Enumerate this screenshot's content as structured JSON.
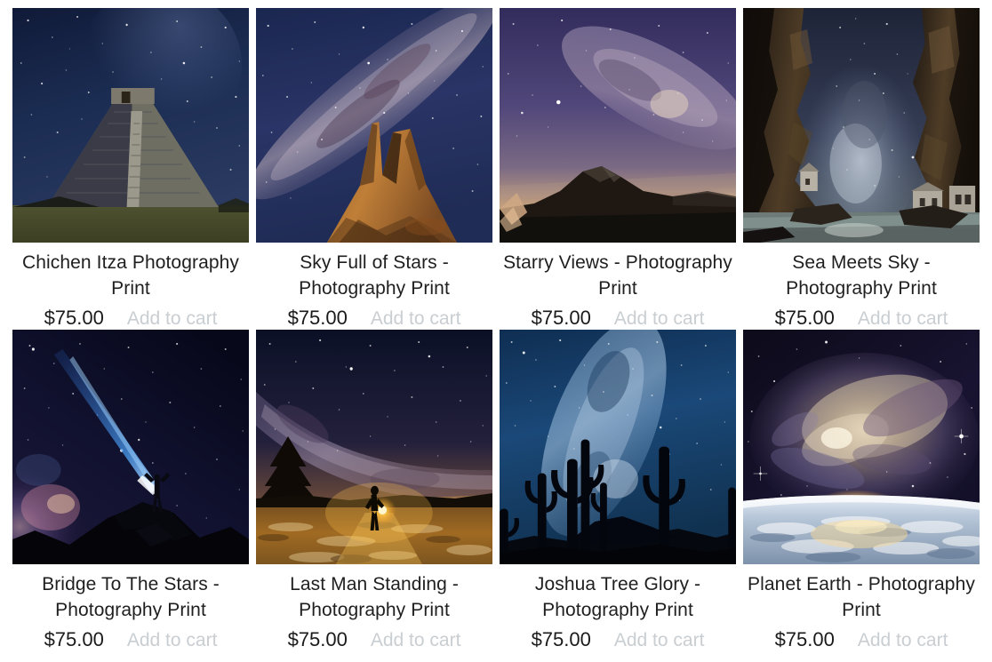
{
  "shop": {
    "grid_columns": 4,
    "currency_symbol": "$",
    "accent_price_color": "#1a1a1a",
    "add_to_cart_color": "#c9ced2",
    "title_color": "#1f1f1f",
    "page_background": "#ffffff"
  },
  "products": [
    {
      "title": "Chichen Itza Photography Print",
      "price": "$75.00",
      "add_to_cart_label": "Add to cart",
      "image_name": "chichen-itza-pyramid-starry-night-photo",
      "image_alt": "Chichen Itza pyramid under a deep blue starry night sky with green grass foreground",
      "palette": {
        "sky_top": "#141e3c",
        "sky_mid": "#1b2c52",
        "sky_low": "#26375e",
        "ground": "#4a4d28",
        "structure": "#8d8b80",
        "structure_shadow": "#2e3040"
      }
    },
    {
      "title": "Sky Full of Stars - Photography Print",
      "price": "$75.00",
      "add_to_cart_label": "Add to cart",
      "image_name": "rock-spires-milky-way-photo",
      "image_alt": "Orange lit rock spires rising toward the Milky Way galactic core",
      "palette": {
        "sky_top": "#1c2a52",
        "sky_mid": "#2c3566",
        "sky_low": "#24335c",
        "galaxy": "#9a8fa8",
        "rock_lit": "#b0702f",
        "rock_dark": "#4a2c16"
      }
    },
    {
      "title": "Starry Views - Photography Print",
      "price": "$75.00",
      "add_to_cart_label": "Add to cart",
      "image_name": "mountain-silhouette-purple-starry-sky-photo",
      "image_alt": "Purple starry sky with the Milky Way above a dark mountain ridge and warm horizon glow",
      "palette": {
        "sky_top": "#3a3564",
        "sky_mid": "#534a75",
        "horizon": "#d9b183",
        "mountain": "#2a2018",
        "foreground": "#1a1510"
      }
    },
    {
      "title": "Sea Meets Sky - Photography Print",
      "price": "$75.00",
      "add_to_cart_label": "Add to cart",
      "image_name": "sea-cave-cliffs-milky-way-photo",
      "image_alt": "Dark cliff walls framing the Milky Way above the sea with small buildings on the rocks",
      "palette": {
        "sky_top": "#2a3048",
        "sky_mid": "#3c4560",
        "galaxy": "#9fb0c4",
        "cliff": "#2b2218",
        "cliff_lit": "#6a5336",
        "sea": "#8fa3a0"
      }
    },
    {
      "title": "Bridge To The Stars - Photography Print",
      "price": "$75.00",
      "add_to_cart_label": "Add to cart",
      "image_name": "person-light-beam-rock-arch-photo",
      "image_alt": "Silhouetted person on a rock arch shining a blue light beam into the Milky Way",
      "palette": {
        "sky_top": "#090a1e",
        "sky_mid": "#131430",
        "galaxy": "#5b4560",
        "beam": "#2d7fe0",
        "rock": "#05050c"
      }
    },
    {
      "title": "Last Man Standing - Photography Print",
      "price": "$75.00",
      "add_to_cart_label": "Add to cart",
      "image_name": "lone-figure-lantern-snow-milky-way-photo",
      "image_alt": "Lone figure holding a glowing lantern on snowy ground beneath the arching Milky Way with a tree at left",
      "palette": {
        "sky_top": "#0e1228",
        "sky_mid": "#26243f",
        "horizon": "#c8862f",
        "ground": "#8a5a22",
        "figure": "#120d08"
      }
    },
    {
      "title": "Joshua Tree Glory - Photography Print",
      "price": "$75.00",
      "add_to_cart_label": "Add to cart",
      "image_name": "saguaro-cactus-silhouettes-blue-milky-way-photo",
      "image_alt": "Saguaro cactus silhouettes against a deep blue starry sky with the Milky Way",
      "palette": {
        "sky_top": "#14365e",
        "sky_mid": "#1d4a79",
        "galaxy": "#5f8fbd",
        "ground": "#050a14"
      }
    },
    {
      "title": "Planet Earth - Photography Print",
      "price": "$75.00",
      "add_to_cart_label": "Add to cart",
      "image_name": "earth-horizon-galaxy-sunrise-photo",
      "image_alt": "Curved Earth horizon with clouds lit by sunrise beneath a bright galaxy in space",
      "palette": {
        "space": "#140f24",
        "galaxy_core": "#d9c3a2",
        "galaxy_outer": "#6a5a80",
        "earth": "#b8c6d6",
        "sun_glow": "#f2d69a"
      }
    }
  ]
}
